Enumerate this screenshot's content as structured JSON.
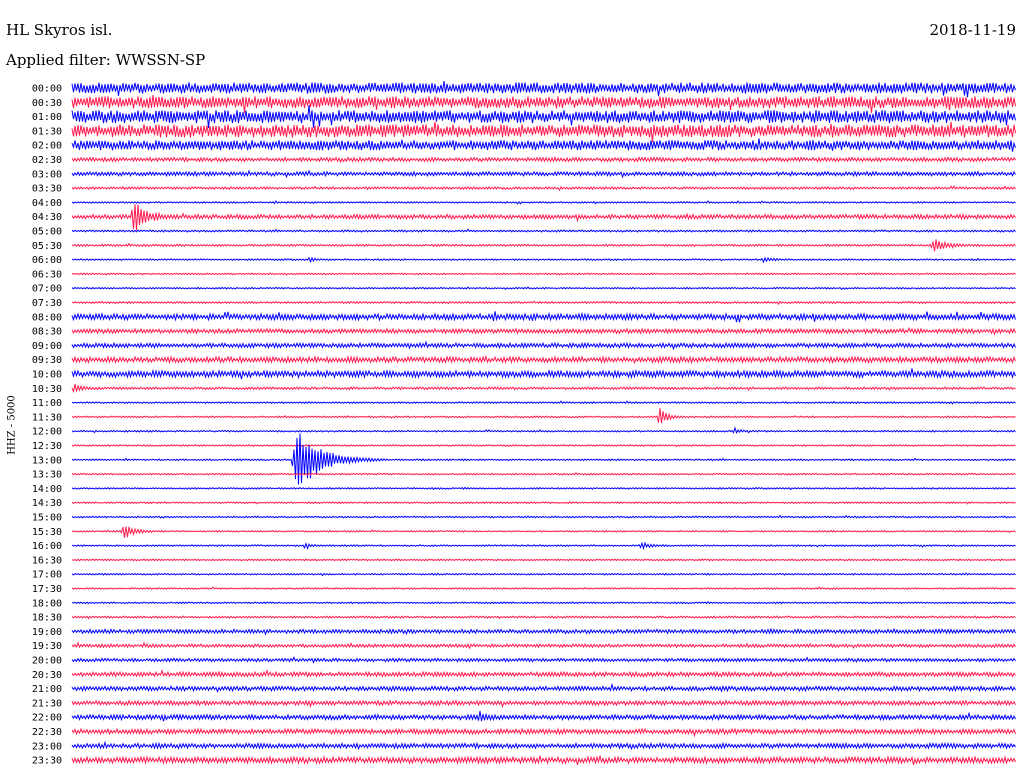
{
  "header": {
    "station": "HL Skyros isl.",
    "date": "2018-11-19",
    "filter": "Applied filter: WWSSN-SP"
  },
  "chart_data": {
    "type": "helicorder",
    "channel_label": "HHZ - 5000",
    "colors": [
      "#0000ff",
      "#ff1a4d"
    ],
    "row_labels": [
      "00:00",
      "00:30",
      "01:00",
      "01:30",
      "02:00",
      "02:30",
      "03:00",
      "03:30",
      "04:00",
      "04:30",
      "05:00",
      "05:30",
      "06:00",
      "06:30",
      "07:00",
      "07:30",
      "08:00",
      "08:30",
      "09:00",
      "09:30",
      "10:00",
      "10:30",
      "11:00",
      "11:30",
      "12:00",
      "12:30",
      "13:00",
      "13:30",
      "14:00",
      "14:30",
      "15:00",
      "15:30",
      "16:00",
      "16:30",
      "17:00",
      "17:30",
      "18:00",
      "18:30",
      "19:00",
      "19:30",
      "20:00",
      "20:30",
      "21:00",
      "21:30",
      "22:00",
      "22:30",
      "23:00",
      "23:30"
    ],
    "noise_levels": [
      5.5,
      6,
      6.5,
      6.5,
      5,
      2,
      2,
      1.2,
      0.8,
      2.2,
      1,
      1,
      0.8,
      0.8,
      0.8,
      1,
      3,
      2.2,
      2.2,
      2.8,
      3.2,
      1.2,
      0.8,
      0.8,
      0.8,
      0.8,
      0.8,
      0.8,
      0.8,
      0.8,
      0.8,
      0.8,
      0.8,
      0.8,
      0.8,
      0.8,
      0.8,
      1,
      2,
      1.6,
      1.6,
      2.2,
      2.2,
      2.2,
      2.4,
      2.4,
      2.4,
      3
    ],
    "events": [
      {
        "row": 9,
        "time_frac": 0.062,
        "amplitude": 16,
        "duration_frac": 0.05
      },
      {
        "row": 11,
        "time_frac": 0.91,
        "amplitude": 6,
        "duration_frac": 0.05
      },
      {
        "row": 12,
        "time_frac": 0.25,
        "amplitude": 2.5,
        "duration_frac": 0.02
      },
      {
        "row": 12,
        "time_frac": 0.73,
        "amplitude": 2.5,
        "duration_frac": 0.03
      },
      {
        "row": 21,
        "time_frac": 0.0,
        "amplitude": 5,
        "duration_frac": 0.03
      },
      {
        "row": 23,
        "time_frac": 0.62,
        "amplitude": 10,
        "duration_frac": 0.03
      },
      {
        "row": 24,
        "time_frac": 0.7,
        "amplitude": 3,
        "duration_frac": 0.02
      },
      {
        "row": 26,
        "time_frac": 0.232,
        "amplitude": 32,
        "duration_frac": 0.1
      },
      {
        "row": 31,
        "time_frac": 0.052,
        "amplitude": 8,
        "duration_frac": 0.04
      },
      {
        "row": 32,
        "time_frac": 0.245,
        "amplitude": 3,
        "duration_frac": 0.02
      },
      {
        "row": 32,
        "time_frac": 0.6,
        "amplitude": 3,
        "duration_frac": 0.04
      },
      {
        "row": 44,
        "time_frac": 0.43,
        "amplitude": 5,
        "duration_frac": 0.02
      }
    ]
  }
}
